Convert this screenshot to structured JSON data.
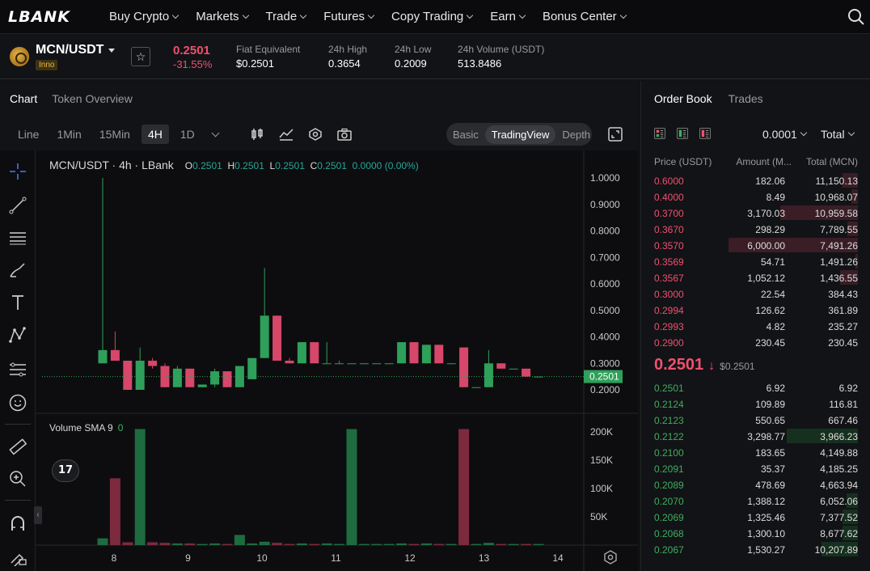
{
  "nav": {
    "logo": "LBANK",
    "items": [
      "Buy Crypto",
      "Markets",
      "Trade",
      "Futures",
      "Copy Trading",
      "Earn",
      "Bonus Center"
    ]
  },
  "ticker": {
    "pair": "MCN/USDT",
    "tag": "Inno",
    "price": "0.2501",
    "change": "-31.55%",
    "stats": [
      {
        "label": "Fiat Equivalent",
        "value": "$0.2501"
      },
      {
        "label": "24h High",
        "value": "0.3654"
      },
      {
        "label": "24h Low",
        "value": "0.2009"
      },
      {
        "label": "24h Volume (USDT)",
        "value": "513.8486"
      }
    ]
  },
  "chart_tabs": [
    "Chart",
    "Token Overview"
  ],
  "timeframes": [
    "Line",
    "1Min",
    "15Min",
    "4H",
    "1D"
  ],
  "active_timeframe": "4H",
  "view_modes": [
    "Basic",
    "TradingView",
    "Depth"
  ],
  "active_view": "TradingView",
  "legend": {
    "title": "MCN/USDT · 4h · LBank",
    "o_label": "O",
    "o": "0.2501",
    "h_label": "H",
    "h": "0.2501",
    "l_label": "L",
    "l": "0.2501",
    "c_label": "C",
    "c": "0.2501",
    "chg": "0.0000 (0.00%)",
    "volume": "Volume SMA 9",
    "volume_value": "0"
  },
  "tv_logo": "17",
  "chart_data": {
    "type": "candlestick",
    "price_axis": {
      "ticks": [
        "1.0000",
        "0.9000",
        "0.8000",
        "0.7000",
        "0.6000",
        "0.5000",
        "0.4000",
        "0.3000",
        "0.2000"
      ],
      "min": 0.2,
      "max": 1.0
    },
    "volume_axis": {
      "ticks": [
        "200K",
        "150K",
        "100K",
        "50K"
      ],
      "max": 200000
    },
    "x_ticks": [
      "8",
      "9",
      "10",
      "11",
      "12",
      "13",
      "14"
    ],
    "last_price_label": "0.2501",
    "candles": [
      {
        "o": 0.3,
        "h": 1.0,
        "l": 0.3,
        "c": 0.35,
        "v": 12000
      },
      {
        "o": 0.35,
        "h": 0.42,
        "l": 0.31,
        "c": 0.31,
        "v": 118000
      },
      {
        "o": 0.31,
        "h": 0.31,
        "l": 0.2,
        "c": 0.2,
        "v": 5000
      },
      {
        "o": 0.2,
        "h": 0.36,
        "l": 0.2,
        "c": 0.31,
        "v": 205000
      },
      {
        "o": 0.31,
        "h": 0.32,
        "l": 0.28,
        "c": 0.29,
        "v": 5000
      },
      {
        "o": 0.29,
        "h": 0.3,
        "l": 0.21,
        "c": 0.21,
        "v": 4000
      },
      {
        "o": 0.21,
        "h": 0.29,
        "l": 0.21,
        "c": 0.28,
        "v": 3000
      },
      {
        "o": 0.28,
        "h": 0.28,
        "l": 0.21,
        "c": 0.21,
        "v": 3000
      },
      {
        "o": 0.21,
        "h": 0.22,
        "l": 0.21,
        "c": 0.22,
        "v": 2000
      },
      {
        "o": 0.22,
        "h": 0.28,
        "l": 0.21,
        "c": 0.27,
        "v": 3000
      },
      {
        "o": 0.27,
        "h": 0.27,
        "l": 0.21,
        "c": 0.21,
        "v": 2000
      },
      {
        "o": 0.21,
        "h": 0.29,
        "l": 0.21,
        "c": 0.29,
        "v": 18000
      },
      {
        "o": 0.24,
        "h": 0.32,
        "l": 0.24,
        "c": 0.32,
        "v": 3000
      },
      {
        "o": 0.32,
        "h": 0.66,
        "l": 0.32,
        "c": 0.48,
        "v": 6000
      },
      {
        "o": 0.48,
        "h": 0.48,
        "l": 0.31,
        "c": 0.31,
        "v": 4000
      },
      {
        "o": 0.31,
        "h": 0.32,
        "l": 0.3,
        "c": 0.3,
        "v": 2000
      },
      {
        "o": 0.3,
        "h": 0.38,
        "l": 0.3,
        "c": 0.38,
        "v": 3000
      },
      {
        "o": 0.38,
        "h": 0.38,
        "l": 0.3,
        "c": 0.3,
        "v": 2000
      },
      {
        "o": 0.3,
        "h": 0.38,
        "l": 0.3,
        "c": 0.3,
        "v": 3000
      },
      {
        "o": 0.3,
        "h": 0.31,
        "l": 0.3,
        "c": 0.3,
        "v": 2000
      },
      {
        "o": 0.3,
        "h": 0.3,
        "l": 0.3,
        "c": 0.3,
        "v": 205000
      },
      {
        "o": 0.3,
        "h": 0.3,
        "l": 0.3,
        "c": 0.3,
        "v": 2000
      },
      {
        "o": 0.3,
        "h": 0.3,
        "l": 0.3,
        "c": 0.3,
        "v": 2000
      },
      {
        "o": 0.3,
        "h": 0.3,
        "l": 0.3,
        "c": 0.3,
        "v": 2000
      },
      {
        "o": 0.3,
        "h": 0.38,
        "l": 0.3,
        "c": 0.38,
        "v": 3000
      },
      {
        "o": 0.38,
        "h": 0.38,
        "l": 0.3,
        "c": 0.3,
        "v": 2000
      },
      {
        "o": 0.3,
        "h": 0.37,
        "l": 0.3,
        "c": 0.37,
        "v": 3000
      },
      {
        "o": 0.37,
        "h": 0.37,
        "l": 0.3,
        "c": 0.3,
        "v": 2000
      },
      {
        "o": 0.3,
        "h": 0.3,
        "l": 0.3,
        "c": 0.3,
        "v": 2000
      },
      {
        "o": 0.36,
        "h": 0.36,
        "l": 0.21,
        "c": 0.21,
        "v": 205000
      },
      {
        "o": 0.21,
        "h": 0.21,
        "l": 0.21,
        "c": 0.21,
        "v": 2000
      },
      {
        "o": 0.21,
        "h": 0.35,
        "l": 0.21,
        "c": 0.3,
        "v": 4000
      },
      {
        "o": 0.3,
        "h": 0.3,
        "l": 0.28,
        "c": 0.28,
        "v": 2000
      },
      {
        "o": 0.28,
        "h": 0.28,
        "l": 0.28,
        "c": 0.28,
        "v": 2000
      },
      {
        "o": 0.28,
        "h": 0.28,
        "l": 0.25,
        "c": 0.25,
        "v": 2000
      },
      {
        "o": 0.25,
        "h": 0.25,
        "l": 0.25,
        "c": 0.25,
        "v": 2000
      }
    ]
  },
  "orderbook": {
    "tabs": [
      "Order Book",
      "Trades"
    ],
    "precision": "0.0001",
    "total_sel": "Total",
    "headers": [
      "Price (USDT)",
      "Amount (M...",
      "Total (MCN)"
    ],
    "asks": [
      {
        "p": "0.6000",
        "a": "182.06",
        "t": "11,150.13",
        "d": 0.12
      },
      {
        "p": "0.4000",
        "a": "8.49",
        "t": "10,968.07",
        "d": 0.05
      },
      {
        "p": "0.3700",
        "a": "3,170.03",
        "t": "10,959.58",
        "d": 0.6
      },
      {
        "p": "0.3670",
        "a": "298.29",
        "t": "7,789.55",
        "d": 0.08
      },
      {
        "p": "0.3570",
        "a": "6,000.00",
        "t": "7,491.26",
        "d": 1.0
      },
      {
        "p": "0.3569",
        "a": "54.71",
        "t": "1,491.26",
        "d": 0.02
      },
      {
        "p": "0.3567",
        "a": "1,052.12",
        "t": "1,436.55",
        "d": 0.14
      },
      {
        "p": "0.3000",
        "a": "22.54",
        "t": "384.43",
        "d": 0.0
      },
      {
        "p": "0.2994",
        "a": "126.62",
        "t": "361.89",
        "d": 0.0
      },
      {
        "p": "0.2993",
        "a": "4.82",
        "t": "235.27",
        "d": 0.0
      },
      {
        "p": "0.2900",
        "a": "230.45",
        "t": "230.45",
        "d": 0.0
      }
    ],
    "mid_price": "0.2501",
    "mid_fiat": "$0.2501",
    "bids": [
      {
        "p": "0.2501",
        "a": "6.92",
        "t": "6.92",
        "d": 0.0
      },
      {
        "p": "0.2124",
        "a": "109.89",
        "t": "116.81",
        "d": 0.0
      },
      {
        "p": "0.2123",
        "a": "550.65",
        "t": "667.46",
        "d": 0.0
      },
      {
        "p": "0.2122",
        "a": "3,298.77",
        "t": "3,966.23",
        "d": 0.55
      },
      {
        "p": "0.2100",
        "a": "183.65",
        "t": "4,149.88",
        "d": 0.0
      },
      {
        "p": "0.2091",
        "a": "35.37",
        "t": "4,185.25",
        "d": 0.0
      },
      {
        "p": "0.2089",
        "a": "478.69",
        "t": "4,663.94",
        "d": 0.0
      },
      {
        "p": "0.2070",
        "a": "1,388.12",
        "t": "6,052.06",
        "d": 0.09
      },
      {
        "p": "0.2069",
        "a": "1,325.46",
        "t": "7,377.52",
        "d": 0.12
      },
      {
        "p": "0.2068",
        "a": "1,300.10",
        "t": "8,677.62",
        "d": 0.12
      },
      {
        "p": "0.2067",
        "a": "1,530.27",
        "t": "10,207.89",
        "d": 0.28
      }
    ]
  }
}
